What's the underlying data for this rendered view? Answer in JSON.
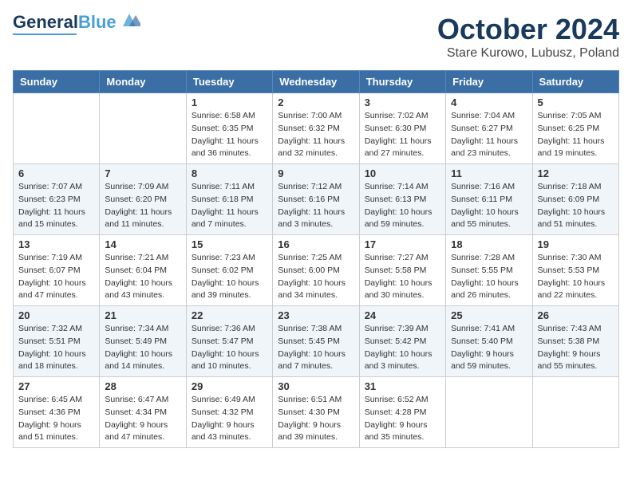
{
  "header": {
    "logo_general": "General",
    "logo_blue": "Blue",
    "month_title": "October 2024",
    "location": "Stare Kurowo, Lubusz, Poland"
  },
  "days_of_week": [
    "Sunday",
    "Monday",
    "Tuesday",
    "Wednesday",
    "Thursday",
    "Friday",
    "Saturday"
  ],
  "weeks": [
    [
      {
        "day": "",
        "sunrise": "",
        "sunset": "",
        "daylight": ""
      },
      {
        "day": "",
        "sunrise": "",
        "sunset": "",
        "daylight": ""
      },
      {
        "day": "1",
        "sunrise": "Sunrise: 6:58 AM",
        "sunset": "Sunset: 6:35 PM",
        "daylight": "Daylight: 11 hours and 36 minutes."
      },
      {
        "day": "2",
        "sunrise": "Sunrise: 7:00 AM",
        "sunset": "Sunset: 6:32 PM",
        "daylight": "Daylight: 11 hours and 32 minutes."
      },
      {
        "day": "3",
        "sunrise": "Sunrise: 7:02 AM",
        "sunset": "Sunset: 6:30 PM",
        "daylight": "Daylight: 11 hours and 27 minutes."
      },
      {
        "day": "4",
        "sunrise": "Sunrise: 7:04 AM",
        "sunset": "Sunset: 6:27 PM",
        "daylight": "Daylight: 11 hours and 23 minutes."
      },
      {
        "day": "5",
        "sunrise": "Sunrise: 7:05 AM",
        "sunset": "Sunset: 6:25 PM",
        "daylight": "Daylight: 11 hours and 19 minutes."
      }
    ],
    [
      {
        "day": "6",
        "sunrise": "Sunrise: 7:07 AM",
        "sunset": "Sunset: 6:23 PM",
        "daylight": "Daylight: 11 hours and 15 minutes."
      },
      {
        "day": "7",
        "sunrise": "Sunrise: 7:09 AM",
        "sunset": "Sunset: 6:20 PM",
        "daylight": "Daylight: 11 hours and 11 minutes."
      },
      {
        "day": "8",
        "sunrise": "Sunrise: 7:11 AM",
        "sunset": "Sunset: 6:18 PM",
        "daylight": "Daylight: 11 hours and 7 minutes."
      },
      {
        "day": "9",
        "sunrise": "Sunrise: 7:12 AM",
        "sunset": "Sunset: 6:16 PM",
        "daylight": "Daylight: 11 hours and 3 minutes."
      },
      {
        "day": "10",
        "sunrise": "Sunrise: 7:14 AM",
        "sunset": "Sunset: 6:13 PM",
        "daylight": "Daylight: 10 hours and 59 minutes."
      },
      {
        "day": "11",
        "sunrise": "Sunrise: 7:16 AM",
        "sunset": "Sunset: 6:11 PM",
        "daylight": "Daylight: 10 hours and 55 minutes."
      },
      {
        "day": "12",
        "sunrise": "Sunrise: 7:18 AM",
        "sunset": "Sunset: 6:09 PM",
        "daylight": "Daylight: 10 hours and 51 minutes."
      }
    ],
    [
      {
        "day": "13",
        "sunrise": "Sunrise: 7:19 AM",
        "sunset": "Sunset: 6:07 PM",
        "daylight": "Daylight: 10 hours and 47 minutes."
      },
      {
        "day": "14",
        "sunrise": "Sunrise: 7:21 AM",
        "sunset": "Sunset: 6:04 PM",
        "daylight": "Daylight: 10 hours and 43 minutes."
      },
      {
        "day": "15",
        "sunrise": "Sunrise: 7:23 AM",
        "sunset": "Sunset: 6:02 PM",
        "daylight": "Daylight: 10 hours and 39 minutes."
      },
      {
        "day": "16",
        "sunrise": "Sunrise: 7:25 AM",
        "sunset": "Sunset: 6:00 PM",
        "daylight": "Daylight: 10 hours and 34 minutes."
      },
      {
        "day": "17",
        "sunrise": "Sunrise: 7:27 AM",
        "sunset": "Sunset: 5:58 PM",
        "daylight": "Daylight: 10 hours and 30 minutes."
      },
      {
        "day": "18",
        "sunrise": "Sunrise: 7:28 AM",
        "sunset": "Sunset: 5:55 PM",
        "daylight": "Daylight: 10 hours and 26 minutes."
      },
      {
        "day": "19",
        "sunrise": "Sunrise: 7:30 AM",
        "sunset": "Sunset: 5:53 PM",
        "daylight": "Daylight: 10 hours and 22 minutes."
      }
    ],
    [
      {
        "day": "20",
        "sunrise": "Sunrise: 7:32 AM",
        "sunset": "Sunset: 5:51 PM",
        "daylight": "Daylight: 10 hours and 18 minutes."
      },
      {
        "day": "21",
        "sunrise": "Sunrise: 7:34 AM",
        "sunset": "Sunset: 5:49 PM",
        "daylight": "Daylight: 10 hours and 14 minutes."
      },
      {
        "day": "22",
        "sunrise": "Sunrise: 7:36 AM",
        "sunset": "Sunset: 5:47 PM",
        "daylight": "Daylight: 10 hours and 10 minutes."
      },
      {
        "day": "23",
        "sunrise": "Sunrise: 7:38 AM",
        "sunset": "Sunset: 5:45 PM",
        "daylight": "Daylight: 10 hours and 7 minutes."
      },
      {
        "day": "24",
        "sunrise": "Sunrise: 7:39 AM",
        "sunset": "Sunset: 5:42 PM",
        "daylight": "Daylight: 10 hours and 3 minutes."
      },
      {
        "day": "25",
        "sunrise": "Sunrise: 7:41 AM",
        "sunset": "Sunset: 5:40 PM",
        "daylight": "Daylight: 9 hours and 59 minutes."
      },
      {
        "day": "26",
        "sunrise": "Sunrise: 7:43 AM",
        "sunset": "Sunset: 5:38 PM",
        "daylight": "Daylight: 9 hours and 55 minutes."
      }
    ],
    [
      {
        "day": "27",
        "sunrise": "Sunrise: 6:45 AM",
        "sunset": "Sunset: 4:36 PM",
        "daylight": "Daylight: 9 hours and 51 minutes."
      },
      {
        "day": "28",
        "sunrise": "Sunrise: 6:47 AM",
        "sunset": "Sunset: 4:34 PM",
        "daylight": "Daylight: 9 hours and 47 minutes."
      },
      {
        "day": "29",
        "sunrise": "Sunrise: 6:49 AM",
        "sunset": "Sunset: 4:32 PM",
        "daylight": "Daylight: 9 hours and 43 minutes."
      },
      {
        "day": "30",
        "sunrise": "Sunrise: 6:51 AM",
        "sunset": "Sunset: 4:30 PM",
        "daylight": "Daylight: 9 hours and 39 minutes."
      },
      {
        "day": "31",
        "sunrise": "Sunrise: 6:52 AM",
        "sunset": "Sunset: 4:28 PM",
        "daylight": "Daylight: 9 hours and 35 minutes."
      },
      {
        "day": "",
        "sunrise": "",
        "sunset": "",
        "daylight": ""
      },
      {
        "day": "",
        "sunrise": "",
        "sunset": "",
        "daylight": ""
      }
    ]
  ]
}
